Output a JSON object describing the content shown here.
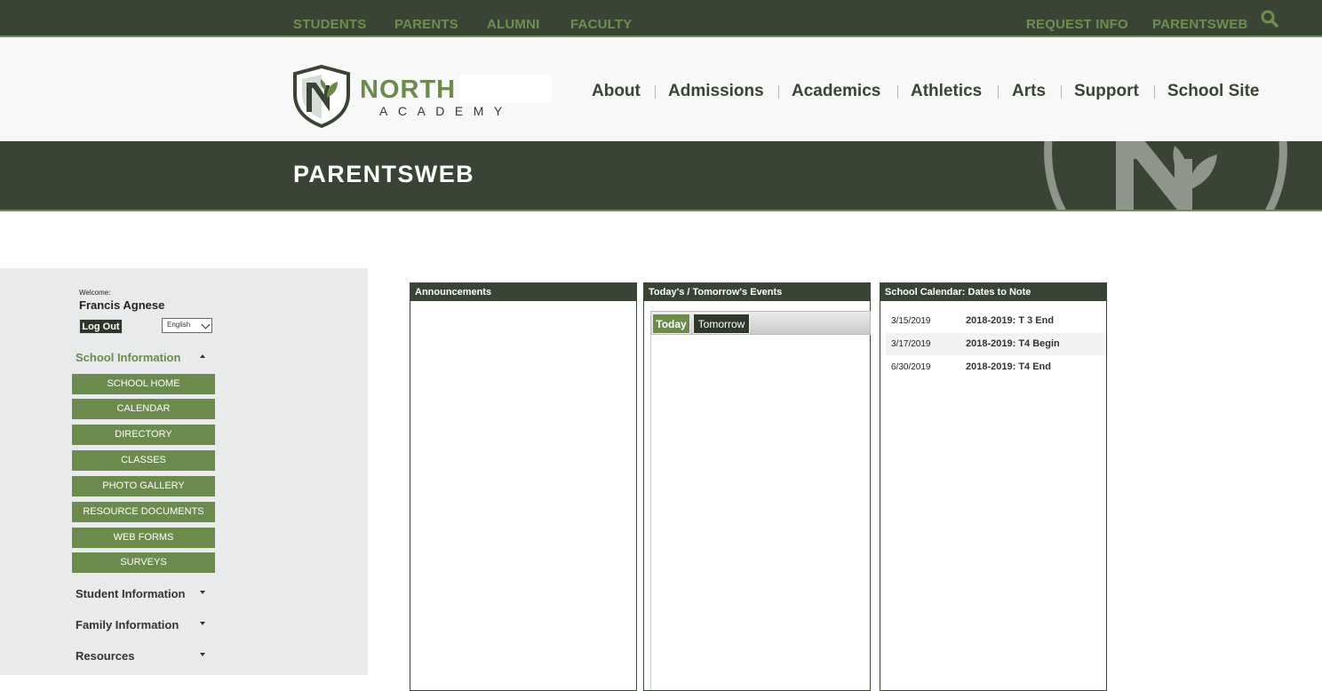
{
  "topnav": {
    "links": [
      "STUDENTS",
      "PARENTS",
      "ALUMNI",
      "FACULTY"
    ],
    "right_links": [
      "REQUEST INFO",
      "PARENTSWEB"
    ]
  },
  "logo": {
    "name_line1": "NORTH",
    "name_line2": "ACADEMY"
  },
  "mainnav": [
    "About",
    "Admissions",
    "Academics",
    "Athletics",
    "Arts",
    "Support",
    "School Site"
  ],
  "banner": {
    "title": "PARENTSWEB"
  },
  "sidebar": {
    "welcome_label": "Welcome:",
    "user_name": "Francis Agnese",
    "logout_label": "Log Out",
    "language": "English",
    "sections": [
      {
        "label": "School Information",
        "expanded": true
      },
      {
        "label": "Student Information",
        "expanded": false
      },
      {
        "label": "Family Information",
        "expanded": false
      },
      {
        "label": "Resources",
        "expanded": false
      }
    ],
    "school_info_items": [
      "SCHOOL HOME",
      "CALENDAR",
      "DIRECTORY",
      "CLASSES",
      "PHOTO GALLERY",
      "RESOURCE DOCUMENTS",
      "WEB FORMS",
      "SURVEYS"
    ]
  },
  "panels": {
    "announcements": {
      "title": "Announcements"
    },
    "events": {
      "title": "Today's / Tomorrow's Events",
      "tab_today": "Today",
      "tab_tomorrow": "Tomorrow",
      "active_tab": "Today"
    },
    "calendar": {
      "title": "School Calendar: Dates to Note",
      "rows": [
        {
          "date": "3/15/2019",
          "event": "2018-2019: T 3 End"
        },
        {
          "date": "3/17/2019",
          "event": "2018-2019: T4 Begin"
        },
        {
          "date": "6/30/2019",
          "event": "2018-2019: T4 End"
        }
      ]
    }
  },
  "colors": {
    "dark_green": "#3a4434",
    "accent_green": "#6a8b4b",
    "sidebar_bg": "#e9eaeb"
  }
}
